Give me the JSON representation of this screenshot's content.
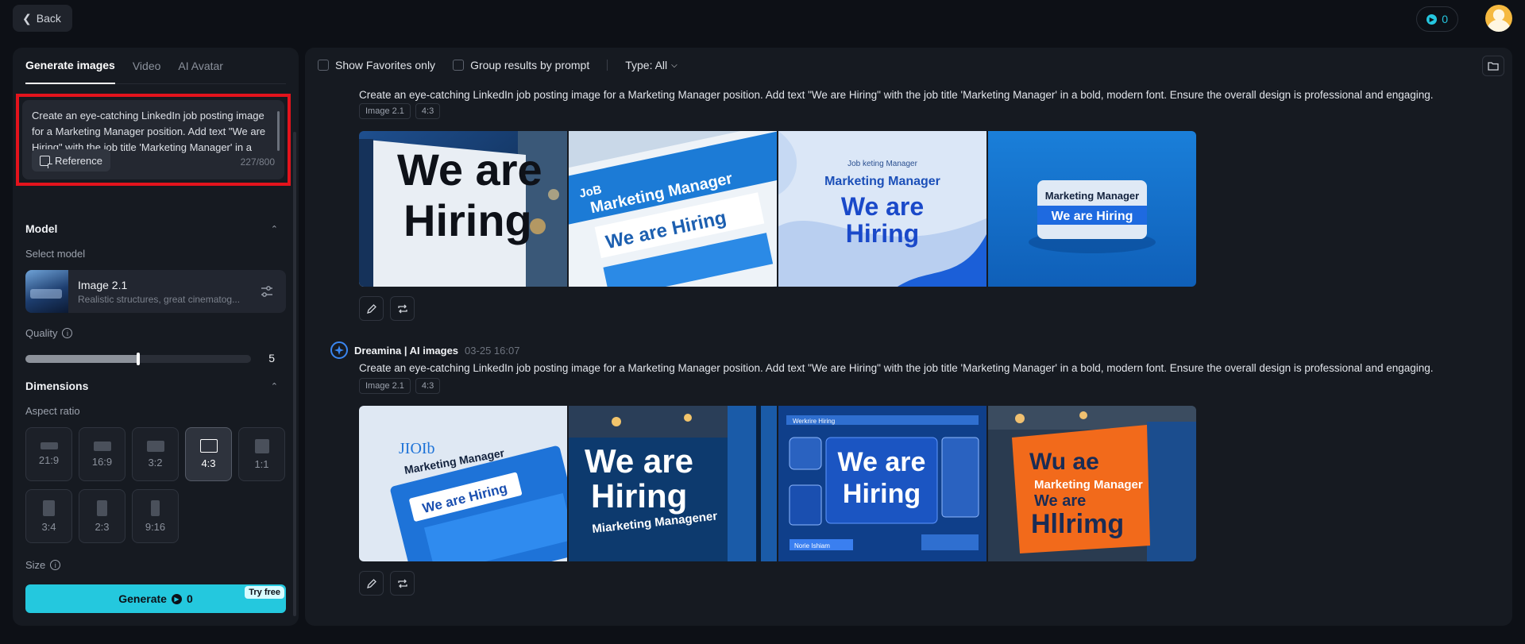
{
  "topbar": {
    "back_label": "Back",
    "credits": "0"
  },
  "left": {
    "tabs": [
      {
        "label": "Generate images",
        "active": true
      },
      {
        "label": "Video"
      },
      {
        "label": "AI Avatar"
      }
    ],
    "prompt": {
      "text": "Create an eye-catching LinkedIn job posting image for a Marketing Manager position. Add text \"We are Hiring\" with the job title 'Marketing Manager' in a bold, modern font. Ensure the overall design is professional and engaging.",
      "reference_label": "Reference",
      "char_count": "227/800"
    },
    "model": {
      "section_title": "Model",
      "select_label": "Select model",
      "name": "Image 2.1",
      "description": "Realistic structures, great cinematog..."
    },
    "quality": {
      "label": "Quality",
      "value": "5",
      "level_fraction": 0.5
    },
    "dimensions": {
      "section_title": "Dimensions",
      "aspect_label": "Aspect ratio",
      "ratios": [
        "21:9",
        "16:9",
        "3:2",
        "4:3",
        "1:1",
        "3:4",
        "2:3",
        "9:16"
      ],
      "selected": "4:3"
    },
    "size_label": "Size",
    "generate": {
      "label": "Generate",
      "cost": "0",
      "badge": "Try free"
    }
  },
  "right": {
    "filters": {
      "favorites": "Show Favorites only",
      "group": "Group results by prompt",
      "type": "Type: All"
    },
    "groups": [
      {
        "brand": "",
        "time": "",
        "prompt": "Create an eye-catching LinkedIn job posting image for a Marketing Manager position. Add text \"We are Hiring\" with the job title 'Marketing Manager' in a bold, modern font. Ensure the overall design is professional and engaging.",
        "tags": [
          "Image 2.1",
          "4:3"
        ],
        "image_texts": [
          [
            "We are",
            "Hiring"
          ],
          [
            "JoB",
            "Marketing Manager",
            "We are Hiring"
          ],
          [
            "Job keting Manager",
            "Marketing Manager",
            "We are",
            "Hiring"
          ],
          [
            "Marketing Manager",
            "We are Hiring"
          ]
        ]
      },
      {
        "brand": "Dreamina | AI images",
        "time": "03-25  16:07",
        "prompt": "Create an eye-catching LinkedIn job posting image for a Marketing Manager position. Add text \"We are Hiring\" with the job title 'Marketing Manager' in a bold, modern font. Ensure the overall design is professional and engaging.",
        "tags": [
          "Image 2.1",
          "4:3"
        ],
        "image_texts": [
          [
            "JIOIb",
            "Marketing Manager",
            "We are Hiring"
          ],
          [
            "We are",
            "Hiring",
            "Miarketing Managener"
          ],
          [
            "Werkrire Hiring",
            "We are",
            "Hiring",
            "Norie Ishiam"
          ],
          [
            "Wu ae",
            "Marketing Manager",
            "We are",
            "Hllrimg"
          ]
        ]
      }
    ]
  }
}
